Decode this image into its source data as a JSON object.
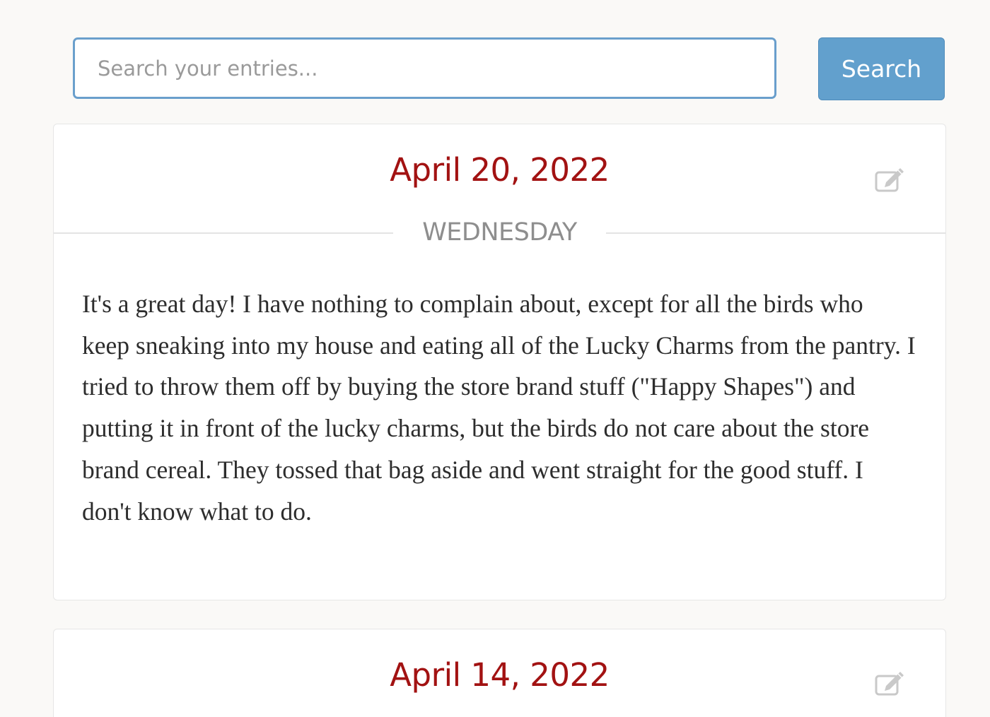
{
  "search": {
    "placeholder": "Search your entries...",
    "value": "",
    "button_label": "Search"
  },
  "entries": [
    {
      "date": "April 20, 2022",
      "weekday": "WEDNESDAY",
      "text": "It's a great day! I have nothing to complain about, except for all the birds who keep sneaking into my house and eating all of the Lucky Charms from the pantry. I tried to throw them off by buying the store brand stuff (\"Happy Shapes\") and putting it in front of the lucky charms, but the birds do not care about the store brand cereal. They tossed that bag aside and went straight for the good stuff. I don't know what to do.",
      "edit_icon": "edit-icon"
    },
    {
      "date": "April 14, 2022",
      "edit_icon": "edit-icon"
    }
  ],
  "colors": {
    "date": "#a21212",
    "weekday": "#8e8e8e",
    "button": "#62a0cd",
    "input_border": "#6a9fcc",
    "background": "#faf9f7"
  }
}
